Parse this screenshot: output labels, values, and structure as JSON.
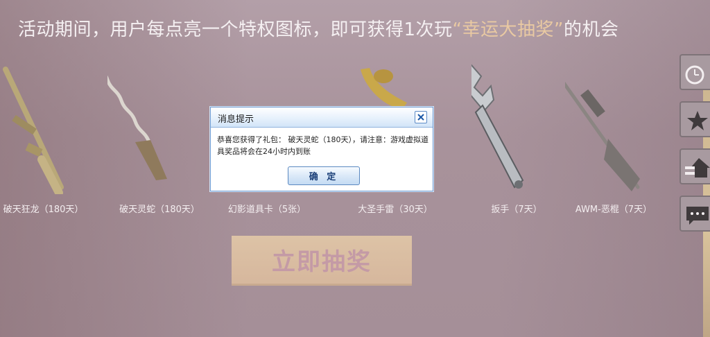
{
  "headline": {
    "prefix": "活动期间，用户每点亮一个特权图标，即可获得1次玩",
    "highlight": "“幸运大抽奖”",
    "suffix": "的机会"
  },
  "prizes": [
    {
      "label": "破天狂龙（180天）",
      "icon": "sniper-rifle-icon"
    },
    {
      "label": "破天灵蛇（180天）",
      "icon": "serpent-blade-icon"
    },
    {
      "label": "幻影道具卡（5张）",
      "icon": "prop-card-icon"
    },
    {
      "label": "大圣手雷（30天）",
      "icon": "banana-grenade-icon"
    },
    {
      "label": "扳手（7天）",
      "icon": "wrench-icon"
    },
    {
      "label": "AWM-恶棍（7天）",
      "icon": "awm-rifle-icon"
    }
  ],
  "draw_button": {
    "label": "立即抽奖"
  },
  "side_tools": [
    "clock-icon",
    "star-icon",
    "house-transfer-icon",
    "chat-icon"
  ],
  "dialog": {
    "title": "消息提示",
    "message": "恭喜您获得了礼包： 破天灵蛇（180天），请注意：游戏虚拟道具奖品将会在24小时内到账",
    "ok_label": "确 定"
  },
  "colors": {
    "highlight": "#e9c9a2",
    "dialog_border": "#6f9ad0",
    "draw_button": "#d6b79d"
  }
}
